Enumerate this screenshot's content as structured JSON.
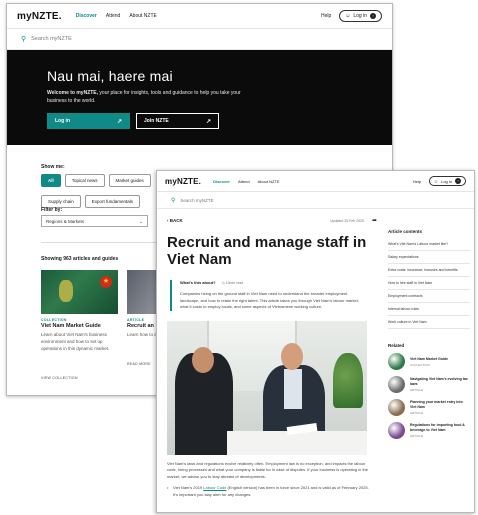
{
  "back_window": {
    "logo": {
      "prefix": "my",
      "brand": "NZTE."
    },
    "nav": {
      "discover": "Discover",
      "attend": "Attend",
      "about": "About NZTE",
      "help": "Help",
      "login": "Log in"
    },
    "search": {
      "placeholder": "Search myNZTE"
    },
    "hero": {
      "title": "Nau mai, haere mai",
      "intro_bold": "Welcome to myNZTE,",
      "intro_rest": " your place for insights, tools and guidance to help you take your business to the world.",
      "login_button": "Log in",
      "join_button": "Join NZTE"
    },
    "filters": {
      "show_me_label": "Show me:",
      "chips": [
        "All",
        "Topical news",
        "Market guides",
        "Supply chain",
        "Export fundamentals"
      ],
      "filter_by_label": "Filter by:",
      "select_value": "Regions & Markets"
    },
    "results": {
      "showing_text": "Showing 963 articles and guides"
    },
    "cards": [
      {
        "kind": "COLLECTION",
        "title": "Viet Nam Market Guide",
        "desc": "Learn about Viet Nam's business environment and how to set up operations in this dynamic market.",
        "view": "VIEW COLLECTION"
      },
      {
        "kind": "ARTICLE",
        "title": "Recruit an",
        "desc": "Learn how to and what it c business in",
        "view": "READ MORE"
      }
    ]
  },
  "front_window": {
    "logo": {
      "prefix": "my",
      "brand": "NZTE."
    },
    "nav": {
      "discover": "Discover",
      "attend": "Attend",
      "about": "About NZTE",
      "help": "Help",
      "login": "Log in"
    },
    "search": {
      "placeholder": "Search myNZTE"
    },
    "back_label": "BACK",
    "updated": "Updated 25 Feb 2025",
    "title": "Recruit and manage staff in Viet Nam",
    "about": {
      "question": "What's this about?",
      "read_time": "10min read",
      "text": "Companies hiring on the ground staff in Viet Nam need to understand the broader employment landscape, and how to retain the right talent. This article takes you through Viet Nam's labour market, what it costs to employ locals, and some aspects of Vietnamese working culture."
    },
    "body": "Viet Nam's laws and regulations evolve relatively often. Employment law is no exception, and impacts the labour code, hiring processes and what your company is liable for in case of disputes. If your business is operating in the market, we advise you to stay abreast of developments.",
    "bullet": {
      "before": "Viet Nam's 2019 ",
      "link": "Labour Code",
      "after": " (English version) has been in force since 2021 and is valid as of February 2025. It's important you stay alert for any changes."
    },
    "contents_title": "Article contents",
    "contents": [
      "What's Viet Nam's Labour market like?",
      "Salary expectations",
      "Extra costs: insurance, bonuses and benefits",
      "How to hire staff in Viet Nam",
      "Employment contracts",
      "Internal labour rules",
      "Work culture in Viet Nam"
    ],
    "related_title": "Related",
    "related": [
      {
        "title": "Viet Nam Market Guide",
        "kind": "COLLECTION",
        "color": "#2f7a4b"
      },
      {
        "title": "Navigating Viet Nam's evolving tax laws",
        "kind": "ARTICLE",
        "color": "#6b6b6b"
      },
      {
        "title": "Planning your market entry into Viet Nam",
        "kind": "ARTICLE",
        "color": "#8a6d4f"
      },
      {
        "title": "Regulations for importing food & beverage to Viet Nam",
        "kind": "ARTICLE",
        "color": "#7b4a8e"
      }
    ]
  }
}
